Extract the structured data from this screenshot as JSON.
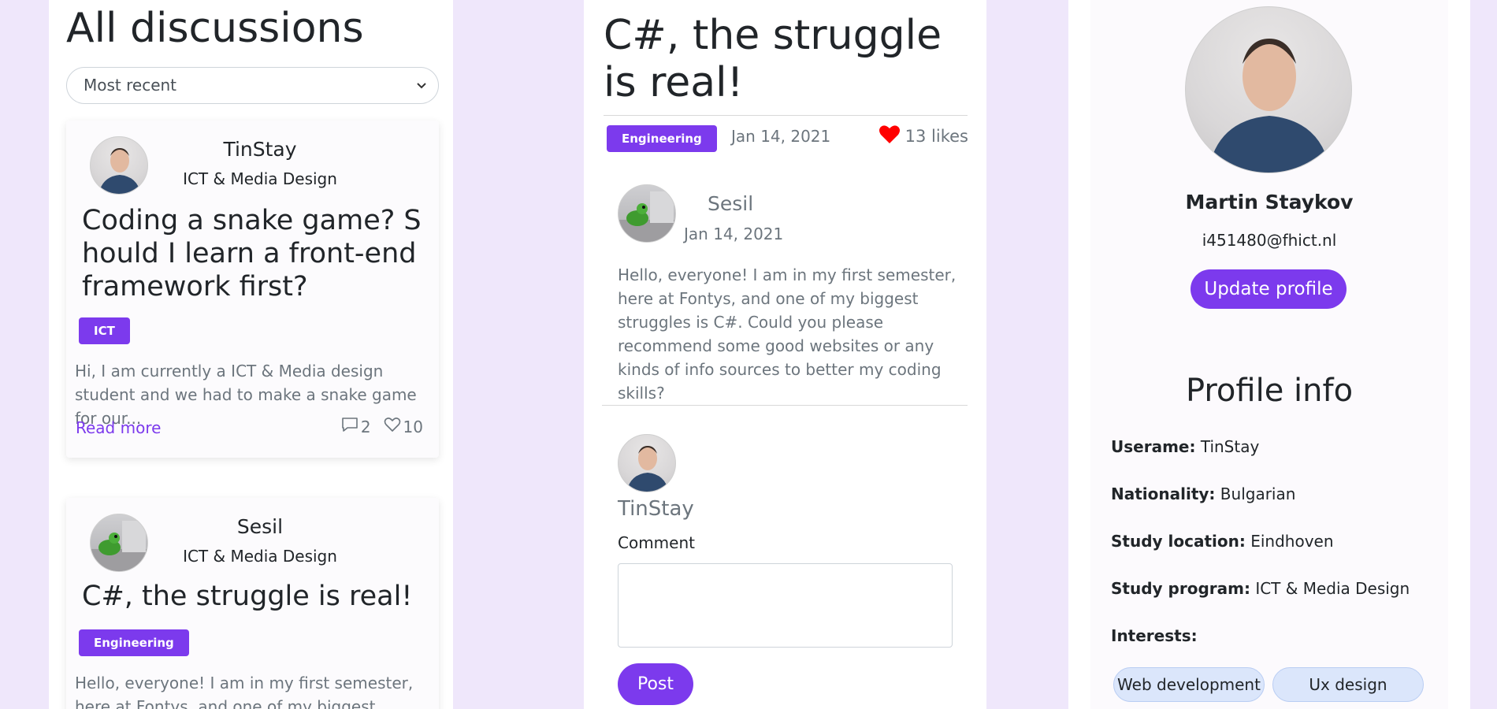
{
  "discussions": {
    "heading": "All discussions",
    "sort": {
      "selected": "Most recent"
    },
    "cards": [
      {
        "user": "TinStay",
        "program": "ICT & Media Design",
        "title": "Coding a snake game? Should I learn a front-end framework first?",
        "tag": "ICT",
        "excerpt": "Hi, I am currently a ICT & Media design student and we had to make a snake game for our...",
        "read_more": "Read more",
        "comments": "2",
        "likes": "10"
      },
      {
        "user": "Sesil",
        "program": "ICT & Media Design",
        "title": "C#, the struggle is real!",
        "tag": "Engineering",
        "excerpt": "Hello, everyone! I am in my first semester, here at Fontys, and one of my biggest struggles is C#."
      }
    ]
  },
  "post": {
    "title": "C#, the struggle is real!",
    "tag": "Engineering",
    "date": "Jan 14, 2021",
    "likes": "13 likes",
    "author": "Sesil",
    "author_date": "Jan 14, 2021",
    "body": "Hello, everyone! I am in my first semester, here at Fontys, and one of my biggest struggles is C#. Could you please recommend some good websites or any kinds of info sources to better my coding skills?",
    "comment_user": "TinStay",
    "comment_label": "Comment",
    "comment_value": "",
    "post_button": "Post"
  },
  "profile": {
    "name": "Martin Staykov",
    "email": "i451480@fhict.nl",
    "update_button": "Update profile",
    "info_title": "Profile info",
    "fields": [
      {
        "label": "Userame:",
        "value": "TinStay"
      },
      {
        "label": "Nationality:",
        "value": "Bulgarian"
      },
      {
        "label": "Study location:",
        "value": "Eindhoven"
      },
      {
        "label": "Study program:",
        "value": "ICT & Media Design"
      },
      {
        "label": "Interests:",
        "value": ""
      }
    ],
    "interests": [
      "Web development",
      "Ux design"
    ]
  },
  "colors": {
    "accent": "#7c3aed",
    "background": "#efe7fb",
    "chip": "#dbe6fb",
    "heart": "#ff0000"
  }
}
